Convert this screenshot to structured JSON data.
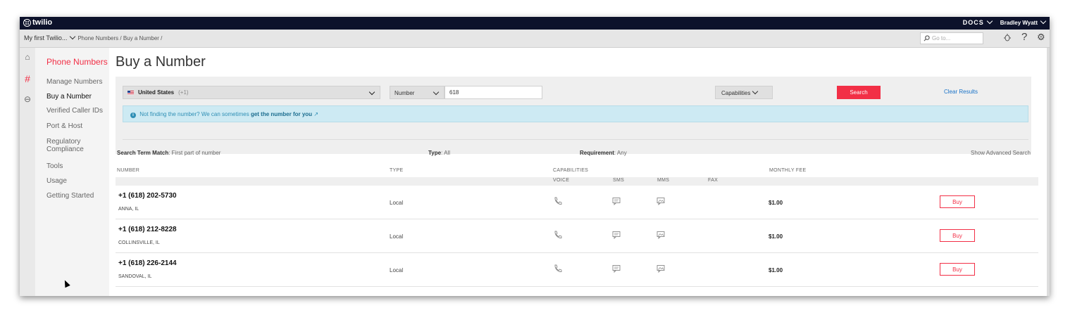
{
  "topbar": {
    "brand": "twilio",
    "docs": "DOCS",
    "user": "Bradley Wyatt"
  },
  "breadcrumb": {
    "project": "My first Twilio...",
    "path": "Phone Numbers / Buy a Number /",
    "goto_placeholder": "Go to..."
  },
  "sidebar": {
    "title": "Phone Numbers",
    "items": [
      {
        "label": "Manage Numbers"
      },
      {
        "label": "Buy a Number"
      },
      {
        "label": "Verified Caller IDs"
      },
      {
        "label": "Port & Host"
      },
      {
        "label": "Regulatory Compliance"
      },
      {
        "label": "Tools"
      },
      {
        "label": "Usage"
      },
      {
        "label": "Getting Started"
      }
    ]
  },
  "page": {
    "title": "Buy a Number"
  },
  "search": {
    "country": "United States",
    "country_code": "(+1)",
    "match_type": "Number",
    "number_value": "618",
    "capabilities_label": "Capabilities",
    "search_button": "Search",
    "clear_link": "Clear Results"
  },
  "info": {
    "text": "Not finding the number? We can sometimes",
    "link": "get the number for you"
  },
  "filters": {
    "term_label": "Search Term Match",
    "term_value": ": First part of number",
    "type_label": "Type",
    "type_value": ": All",
    "req_label": "Requirement",
    "req_value": ": Any",
    "advanced": "Show Advanced Search"
  },
  "columns": {
    "number": "NUMBER",
    "type": "TYPE",
    "capabilities": "CAPABILITIES",
    "voice": "VOICE",
    "sms": "SMS",
    "mms": "MMS",
    "fax": "FAX",
    "fee": "MONTHLY FEE"
  },
  "results": [
    {
      "number": "+1 (618) 202-5730",
      "location": "ANNA, IL",
      "type": "Local",
      "fee": "$1.00",
      "buy": "Buy"
    },
    {
      "number": "+1 (618) 212-8228",
      "location": "COLLINSVILLE, IL",
      "type": "Local",
      "fee": "$1.00",
      "buy": "Buy"
    },
    {
      "number": "+1 (618) 226-2144",
      "location": "SANDOVAL, IL",
      "type": "Local",
      "fee": "$1.00",
      "buy": "Buy"
    }
  ],
  "colors": {
    "accent": "#f22f46",
    "topbar": "#0d122b",
    "info_bg": "#cdeaf3"
  }
}
